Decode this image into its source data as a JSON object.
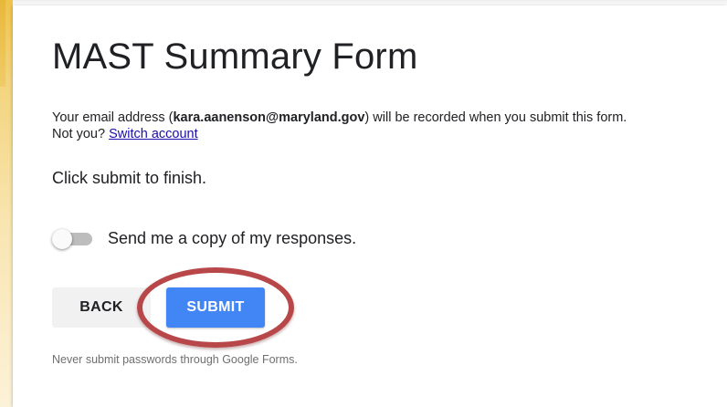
{
  "form": {
    "title": "MAST Summary Form",
    "email_notice": {
      "prefix": "Your email address (",
      "email": "kara.aanenson@maryland.gov",
      "suffix": ") will be recorded when you submit this form.",
      "not_you": "Not you?",
      "switch_account_label": "Switch account"
    },
    "finish_text": "Click submit to finish.",
    "copy_toggle": {
      "label": "Send me a copy of my responses.",
      "checked": false
    },
    "buttons": {
      "back_label": "BACK",
      "submit_label": "SUBMIT"
    },
    "footer_note": "Never submit passwords through Google Forms."
  },
  "colors": {
    "accent": "#4285f4",
    "highlight_ring": "#b8474a",
    "left_strip": "#f0c34a"
  }
}
